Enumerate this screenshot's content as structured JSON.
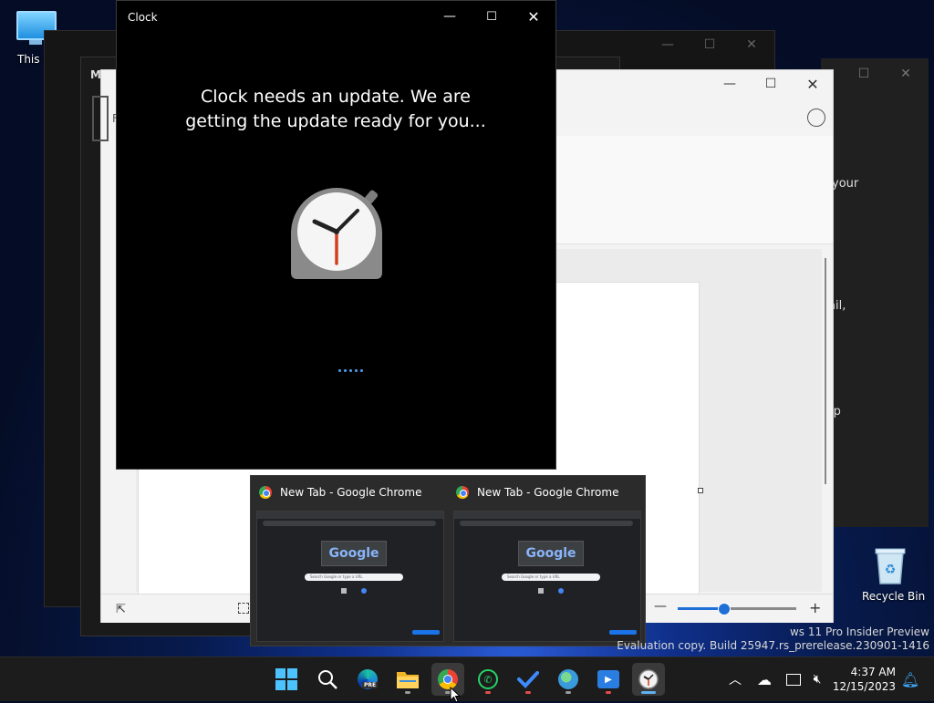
{
  "desktop": {
    "this_pc_label": "This P",
    "recycle_bin_label": "Recycle Bin"
  },
  "bg_window": {
    "short_title": "M",
    "fragments": [
      "your",
      "ail,",
      "lp"
    ],
    "side_letter": "F"
  },
  "clock_window": {
    "title": "Clock",
    "message": "Clock needs an update. We are getting the update ready for you...",
    "accent": "#4ea1f3"
  },
  "chrome_previews": [
    {
      "title": "New Tab - Google Chrome",
      "logo_text": "Google",
      "search_placeholder": "Search Google or type a URL"
    },
    {
      "title": "New Tab - Google Chrome",
      "logo_text": "Google",
      "search_placeholder": "Search Google or type a URL"
    }
  ],
  "watermark": {
    "line1": "ws 11 Pro Insider Preview",
    "line2": "Evaluation copy. Build 25947.rs_prerelease.230901-1416"
  },
  "taskbar": {
    "apps": [
      {
        "name": "start",
        "icon": "windows-logo"
      },
      {
        "name": "search",
        "icon": "search-icon"
      },
      {
        "name": "edge",
        "icon": "edge-icon",
        "badge": "PRE"
      },
      {
        "name": "file-explorer",
        "icon": "folder-icon"
      },
      {
        "name": "chrome",
        "icon": "chrome-icon"
      },
      {
        "name": "whatsapp",
        "icon": "whatsapp-icon"
      },
      {
        "name": "todo",
        "icon": "check-icon"
      },
      {
        "name": "maps",
        "icon": "globe-icon"
      },
      {
        "name": "media",
        "icon": "play-icon"
      },
      {
        "name": "clock",
        "icon": "clock-icon"
      }
    ],
    "time": "4:37 AM",
    "date": "12/15/2023"
  }
}
